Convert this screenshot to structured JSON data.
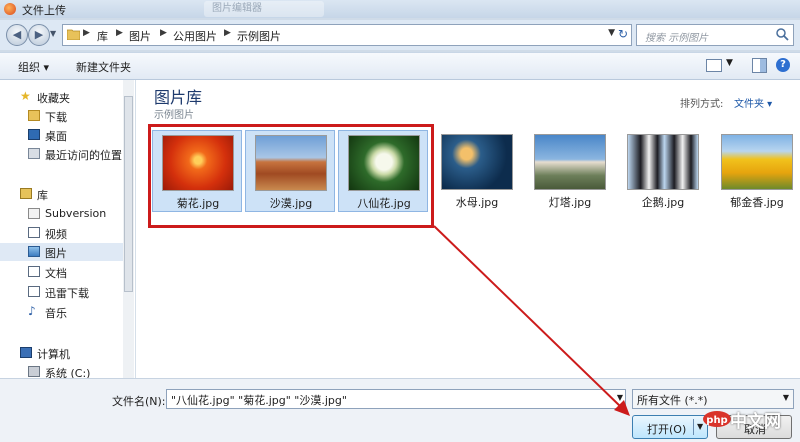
{
  "window": {
    "title": "文件上传",
    "background_tab": "图片编辑器"
  },
  "nav": {
    "back_icon": "arrow-left-icon",
    "forward_icon": "arrow-right-icon",
    "breadcrumb": [
      "库",
      "图片",
      "公用图片",
      "示例图片"
    ],
    "search_placeholder": "搜索 示例图片"
  },
  "toolbar": {
    "organize": "组织 ▾",
    "new_folder": "新建文件夹"
  },
  "sidebar": {
    "items": [
      {
        "label": "收藏夹",
        "icon": "star-icon"
      },
      {
        "label": "下载",
        "icon": "download-folder-icon"
      },
      {
        "label": "桌面",
        "icon": "desktop-icon"
      },
      {
        "label": "最近访问的位置",
        "icon": "recent-places-icon"
      },
      {
        "label": "库",
        "icon": "library-icon"
      },
      {
        "label": "Subversion",
        "icon": "subversion-icon"
      },
      {
        "label": "视频",
        "icon": "video-icon"
      },
      {
        "label": "图片",
        "icon": "pictures-icon"
      },
      {
        "label": "文档",
        "icon": "documents-icon"
      },
      {
        "label": "迅雷下载",
        "icon": "folder-icon"
      },
      {
        "label": "音乐",
        "icon": "music-icon"
      },
      {
        "label": "计算机",
        "icon": "computer-icon"
      },
      {
        "label": "系统 (C:)",
        "icon": "drive-icon"
      }
    ],
    "selected": "图片"
  },
  "content": {
    "library_title": "图片库",
    "library_subtitle": "示例图片",
    "arrange_label": "排列方式:",
    "arrange_value": "文件夹 ▾",
    "files": [
      {
        "name": "菊花.jpg",
        "selected": true
      },
      {
        "name": "沙漠.jpg",
        "selected": true
      },
      {
        "name": "八仙花.jpg",
        "selected": true
      },
      {
        "name": "水母.jpg",
        "selected": false
      },
      {
        "name": "灯塔.jpg",
        "selected": false
      },
      {
        "name": "企鹅.jpg",
        "selected": false
      },
      {
        "name": "郁金香.jpg",
        "selected": false
      }
    ]
  },
  "bottom": {
    "filename_label": "文件名(N):",
    "filename_value": "\"八仙花.jpg\" \"菊花.jpg\" \"沙漠.jpg\"",
    "filetype_value": "所有文件 (*.*)",
    "open_button": "打开(O)",
    "cancel_button": "取消",
    "watermark": "中文网"
  },
  "colors": {
    "annotation_red": "#cc1b1b",
    "library_title": "#1e3a6d",
    "selection_blue": "#cde2f7"
  }
}
